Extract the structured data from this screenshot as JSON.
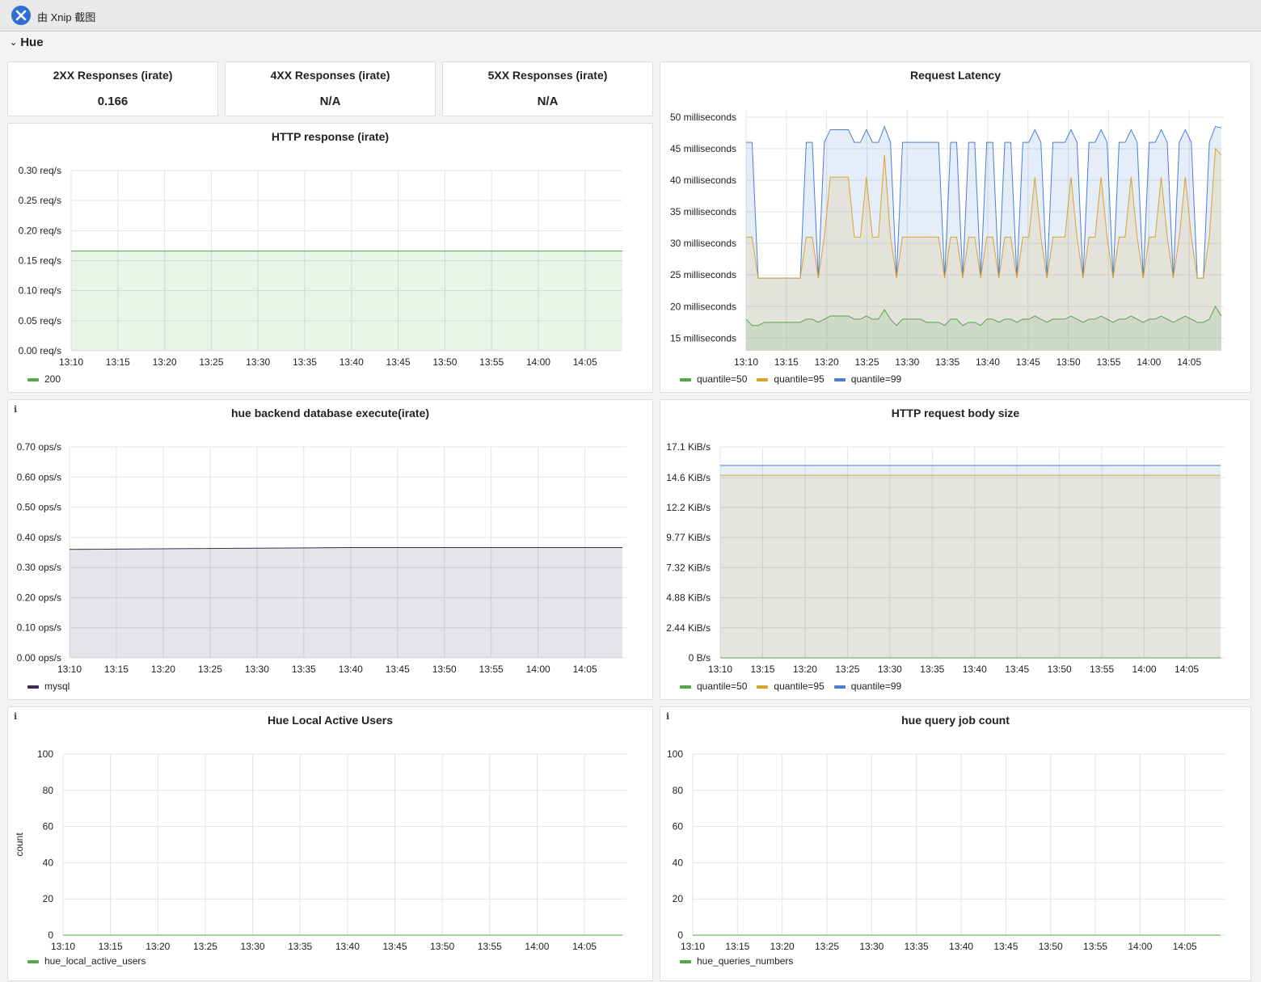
{
  "window": {
    "title": "由 Xnip 截图"
  },
  "row": {
    "title": "Hue"
  },
  "colors": {
    "green": "#56a64b",
    "yellow": "#d9a32e",
    "blue": "#4a7fd4",
    "purple": "#3b2d54"
  },
  "stats": [
    {
      "title": "2XX Responses (irate)",
      "value": "0.166"
    },
    {
      "title": "4XX Responses (irate)",
      "value": "N/A"
    },
    {
      "title": "5XX Responses (irate)",
      "value": "N/A"
    }
  ],
  "panels": {
    "http_response": {
      "title": "HTTP response (irate)",
      "legend": [
        {
          "name": "200",
          "color": "#56a64b"
        }
      ]
    },
    "request_latency": {
      "title": "Request Latency",
      "legend": [
        {
          "name": "quantile=50",
          "color": "#56a64b"
        },
        {
          "name": "quantile=95",
          "color": "#d9a32e"
        },
        {
          "name": "quantile=99",
          "color": "#4a7fd4"
        }
      ]
    },
    "db_execute": {
      "title": "hue backend database execute(irate)",
      "info": "i",
      "legend": [
        {
          "name": "mysql",
          "color": "#3b2d54"
        }
      ]
    },
    "body_size": {
      "title": "HTTP request body size",
      "legend": [
        {
          "name": "quantile=50",
          "color": "#56a64b"
        },
        {
          "name": "quantile=95",
          "color": "#d9a32e"
        },
        {
          "name": "quantile=99",
          "color": "#4a7fd4"
        }
      ]
    },
    "active_users": {
      "title": "Hue Local Active Users",
      "info": "i",
      "legend": [
        {
          "name": "hue_local_active_users",
          "color": "#56a64b"
        }
      ]
    },
    "query_job": {
      "title": "hue query job count",
      "info": "i",
      "legend": [
        {
          "name": "hue_queries_numbers",
          "color": "#56a64b"
        }
      ]
    }
  },
  "chart_data": [
    {
      "id": "http_response",
      "type": "area",
      "title": "HTTP response (irate)",
      "x_ticks": [
        "13:10",
        "13:15",
        "13:20",
        "13:25",
        "13:30",
        "13:35",
        "13:40",
        "13:45",
        "13:50",
        "13:55",
        "14:00",
        "14:05"
      ],
      "y_ticks": [
        "0.00 req/s",
        "0.05 req/s",
        "0.10 req/s",
        "0.15 req/s",
        "0.20 req/s",
        "0.25 req/s",
        "0.30 req/s"
      ],
      "ylim": [
        0,
        0.3
      ],
      "grid": true,
      "legend_position": "bottom-left",
      "series": [
        {
          "name": "200",
          "color": "#56a64b",
          "start_min": 0,
          "end_min": 59,
          "values": [
            0.166,
            0.166
          ]
        }
      ]
    },
    {
      "id": "request_latency",
      "type": "area",
      "title": "Request Latency",
      "x_ticks": [
        "13:10",
        "13:15",
        "13:20",
        "13:25",
        "13:30",
        "13:35",
        "13:40",
        "13:45",
        "13:50",
        "13:55",
        "14:00",
        "14:05"
      ],
      "y_ticks": [
        "15 milliseconds",
        "20 milliseconds",
        "25 milliseconds",
        "30 milliseconds",
        "35 milliseconds",
        "40 milliseconds",
        "45 milliseconds",
        "50 milliseconds"
      ],
      "y_tick_values": [
        15,
        20,
        25,
        30,
        35,
        40,
        45,
        50
      ],
      "ylim": [
        13,
        51
      ],
      "grid": true,
      "legend_position": "bottom-left",
      "series": [
        {
          "name": "quantile=99",
          "color": "#4a7fd4",
          "start_min": 0,
          "end_min": 59,
          "values": [
            46,
            46,
            24.5,
            24.5,
            24.5,
            24.5,
            24.5,
            24.5,
            24.5,
            24.5,
            46,
            46,
            24.5,
            46,
            48,
            48,
            48,
            48,
            46,
            46,
            48,
            46,
            46,
            48.5,
            46,
            24.5,
            46,
            46,
            46,
            46,
            46,
            46,
            46,
            24.5,
            46,
            46,
            24.5,
            46,
            46,
            24.5,
            46,
            46,
            24.5,
            46,
            46,
            24.5,
            46,
            46,
            48,
            46,
            24.5,
            46,
            46,
            46,
            48,
            46,
            24.5,
            46,
            46,
            48,
            46,
            24.5,
            46,
            46,
            48,
            46,
            24.5,
            46,
            46,
            48,
            46,
            24.5,
            46,
            48,
            46,
            24.5,
            24.5,
            46,
            48.5,
            48.3
          ]
        },
        {
          "name": "quantile=95",
          "color": "#d9a32e",
          "start_min": 0,
          "end_min": 59,
          "values": [
            31,
            31,
            24.5,
            24.5,
            24.5,
            24.5,
            24.5,
            24.5,
            24.5,
            24.5,
            31,
            31,
            24.5,
            31,
            40.5,
            40.5,
            40.5,
            40.5,
            31,
            31,
            40.5,
            31,
            31,
            44,
            31,
            24.5,
            31,
            31,
            31,
            31,
            31,
            31,
            31,
            24.5,
            31,
            31,
            24.5,
            31,
            31,
            24.5,
            31,
            31,
            24.5,
            31,
            31,
            24.5,
            31,
            31,
            40.5,
            31,
            24.5,
            31,
            31,
            31,
            40.5,
            31,
            24.5,
            31,
            31,
            40.5,
            31,
            24.5,
            31,
            31,
            40.5,
            31,
            24.5,
            31,
            31,
            40.5,
            31,
            24.5,
            31,
            40.5,
            31,
            24.5,
            24.5,
            31,
            45,
            44
          ]
        },
        {
          "name": "quantile=50",
          "color": "#56a64b",
          "start_min": 0,
          "end_min": 59,
          "values": [
            18,
            17,
            17,
            17.5,
            17.5,
            17.5,
            17.5,
            17.5,
            17.5,
            17.5,
            18,
            18,
            17.5,
            18,
            18.5,
            18.5,
            18.5,
            18.5,
            18,
            18,
            18.5,
            18,
            18,
            19.5,
            18,
            17,
            18,
            18,
            18,
            18,
            17.5,
            17.5,
            17.5,
            17,
            18,
            18,
            17,
            17.5,
            17.5,
            17,
            18,
            18,
            17.5,
            18,
            18,
            17.5,
            18,
            18,
            18.5,
            18,
            17.5,
            18,
            18,
            18,
            18.5,
            18,
            17.5,
            18,
            18,
            18.5,
            18,
            17.5,
            18,
            18,
            18.5,
            18,
            17.5,
            18,
            18,
            18.5,
            18,
            17.5,
            18,
            18.5,
            18,
            17.5,
            17.5,
            18,
            20,
            18.5
          ]
        }
      ]
    },
    {
      "id": "db_execute",
      "type": "area",
      "title": "hue backend database execute(irate)",
      "x_ticks": [
        "13:10",
        "13:15",
        "13:20",
        "13:25",
        "13:30",
        "13:35",
        "13:40",
        "13:45",
        "13:50",
        "13:55",
        "14:00",
        "14:05"
      ],
      "y_ticks": [
        "0.00 ops/s",
        "0.10 ops/s",
        "0.20 ops/s",
        "0.30 ops/s",
        "0.40 ops/s",
        "0.50 ops/s",
        "0.60 ops/s",
        "0.70 ops/s"
      ],
      "ylim": [
        0,
        0.7
      ],
      "grid": true,
      "legend_position": "bottom-left",
      "series": [
        {
          "name": "mysql",
          "color": "#3b2d54",
          "start_min": 0,
          "end_min": 59,
          "values": [
            0.36,
            0.366,
            0.366
          ]
        }
      ]
    },
    {
      "id": "body_size",
      "type": "area",
      "title": "HTTP request body size",
      "x_ticks": [
        "13:10",
        "13:15",
        "13:20",
        "13:25",
        "13:30",
        "13:35",
        "13:40",
        "13:45",
        "13:50",
        "13:55",
        "14:00",
        "14:05"
      ],
      "y_ticks": [
        "0 B/s",
        "2.44 KiB/s",
        "4.88 KiB/s",
        "7.32 KiB/s",
        "9.77 KiB/s",
        "12.2 KiB/s",
        "14.6 KiB/s",
        "17.1 KiB/s"
      ],
      "y_tick_values": [
        0,
        2.44,
        4.88,
        7.32,
        9.77,
        12.2,
        14.6,
        17.1
      ],
      "ylim": [
        0,
        17.1
      ],
      "grid": true,
      "legend_position": "bottom-left",
      "series": [
        {
          "name": "quantile=99",
          "color": "#4a7fd4",
          "start_min": 0,
          "end_min": 59,
          "values": [
            15.6,
            15.6
          ]
        },
        {
          "name": "quantile=95",
          "color": "#d9a32e",
          "start_min": 0,
          "end_min": 59,
          "values": [
            14.8,
            14.8
          ]
        },
        {
          "name": "quantile=50",
          "color": "#56a64b",
          "start_min": 0,
          "end_min": 59,
          "values": [
            0,
            0
          ]
        }
      ]
    },
    {
      "id": "active_users",
      "type": "line",
      "title": "Hue Local Active Users",
      "ylabel": "count",
      "x_ticks": [
        "13:10",
        "13:15",
        "13:20",
        "13:25",
        "13:30",
        "13:35",
        "13:40",
        "13:45",
        "13:50",
        "13:55",
        "14:00",
        "14:05"
      ],
      "y_ticks": [
        "0",
        "20",
        "40",
        "60",
        "80",
        "100"
      ],
      "ylim": [
        0,
        100
      ],
      "grid": true,
      "legend_position": "bottom-left",
      "series": [
        {
          "name": "hue_local_active_users",
          "color": "#56a64b",
          "start_min": 0,
          "end_min": 59,
          "values": [
            0,
            0
          ]
        }
      ]
    },
    {
      "id": "query_job",
      "type": "line",
      "title": "hue query job count",
      "x_ticks": [
        "13:10",
        "13:15",
        "13:20",
        "13:25",
        "13:30",
        "13:35",
        "13:40",
        "13:45",
        "13:50",
        "13:55",
        "14:00",
        "14:05"
      ],
      "y_ticks": [
        "0",
        "20",
        "40",
        "60",
        "80",
        "100"
      ],
      "ylim": [
        0,
        100
      ],
      "grid": true,
      "legend_position": "bottom-left",
      "series": [
        {
          "name": "hue_queries_numbers",
          "color": "#56a64b",
          "start_min": 0,
          "end_min": 59,
          "values": [
            0,
            0
          ]
        }
      ]
    }
  ]
}
